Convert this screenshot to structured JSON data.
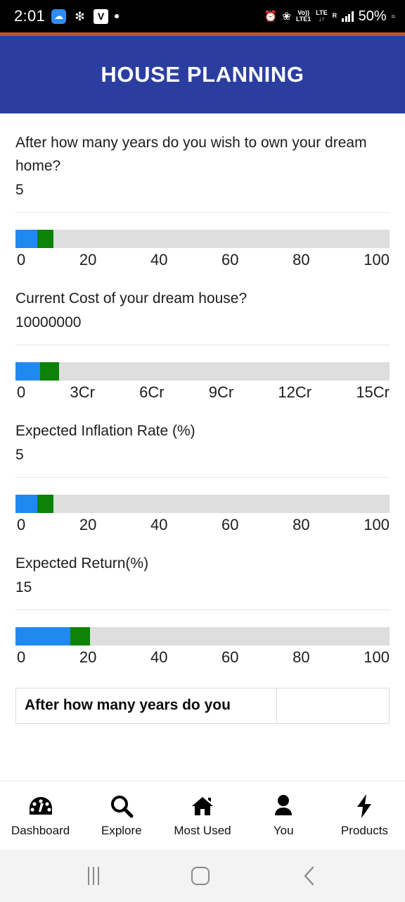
{
  "status_bar": {
    "clock": "2:01",
    "icons": [
      "notification-badge-icon",
      "apps-icon",
      "v-app-icon",
      "dot-icon"
    ],
    "right_icons": [
      "alarm-icon",
      "bluetooth-icon",
      "volte-icon",
      "lte-roaming-icon",
      "signal-bars-icon"
    ],
    "volte_top": "Vo))",
    "volte_bottom": "LTE1",
    "lte_top": "LTE",
    "lte_bottom": "↓↑",
    "roaming": "R",
    "battery_percent": "50%"
  },
  "header": {
    "title": "HOUSE PLANNING",
    "bg_color": "#2b3ea0",
    "accent_color": "#c4512c"
  },
  "colors": {
    "slider_filled": "#2089f0",
    "slider_marker": "#0c8206",
    "slider_track": "#dedede"
  },
  "fields": [
    {
      "label": "After how many years do you wish to own your dream home?",
      "value": "5",
      "blue_pct": 5.8,
      "green_pct": 4.4,
      "ticks": [
        "0",
        "20",
        "40",
        "60",
        "80",
        "100"
      ]
    },
    {
      "label": "Current Cost of your dream house?",
      "value": "10000000",
      "blue_pct": 6.6,
      "green_pct": 5.0,
      "ticks": [
        "0",
        "3Cr",
        "6Cr",
        "9Cr",
        "12Cr",
        "15Cr"
      ]
    },
    {
      "label": "Expected Inflation Rate (%)",
      "value": "5",
      "blue_pct": 5.8,
      "green_pct": 4.4,
      "ticks": [
        "0",
        "20",
        "40",
        "60",
        "80",
        "100"
      ]
    },
    {
      "label": "Expected Return(%)",
      "value": "15",
      "blue_pct": 14.7,
      "green_pct": 5.3,
      "ticks": [
        "0",
        "20",
        "40",
        "60",
        "80",
        "100"
      ]
    }
  ],
  "result_table": {
    "row_label": "After how many years do you",
    "row_value": ""
  },
  "bottom_nav": [
    {
      "label": "Dashboard",
      "icon": "dashboard-gauge-icon"
    },
    {
      "label": "Explore",
      "icon": "search-icon"
    },
    {
      "label": "Most Used",
      "icon": "home-icon"
    },
    {
      "label": "You",
      "icon": "person-icon"
    },
    {
      "label": "Products",
      "icon": "lightning-bolt-icon"
    }
  ],
  "system_nav": {
    "recents": "recents-icon",
    "home": "home-button-icon",
    "back": "back-icon"
  }
}
